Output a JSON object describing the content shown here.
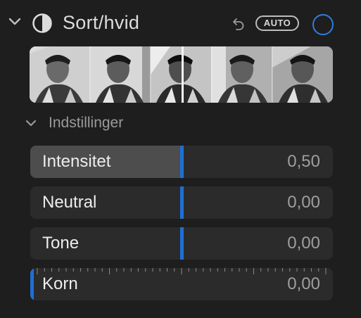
{
  "header": {
    "title": "Sort/hvid",
    "auto_label": "AUTO",
    "icons": {
      "collapse": "chevron-down-icon",
      "effect": "half-circle-bw-icon",
      "undo": "undo-arrow-icon",
      "enable": "circle-toggle-icon"
    }
  },
  "thumbnails": {
    "count": 5,
    "description_icon": "photo-thumbnail-icon"
  },
  "settings": {
    "title": "Indstillinger",
    "sliders": [
      {
        "label": "Intensitet",
        "value": "0,50",
        "level": 0.5
      },
      {
        "label": "Neutral",
        "value": "0,00",
        "level": 0.5
      },
      {
        "label": "Tone",
        "value": "0,00",
        "level": 0.5
      },
      {
        "label": "Korn",
        "value": "0,00",
        "level": 0.0
      }
    ]
  },
  "colors": {
    "background": "#1e1e1e",
    "accent": "#1f6fd6",
    "toggle": "#2f7de1"
  }
}
